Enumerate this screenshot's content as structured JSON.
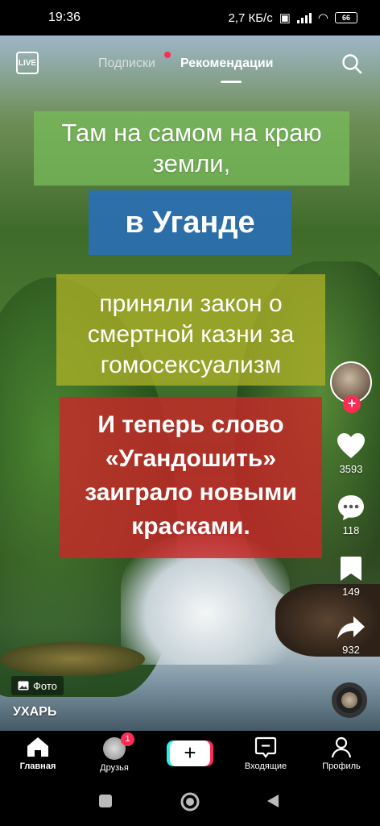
{
  "status_bar": {
    "time": "19:36",
    "net_speed": "2,7 КБ/с",
    "battery": "66"
  },
  "top_nav": {
    "live_label": "LIVE",
    "tabs": [
      {
        "label": "Подписки"
      },
      {
        "label": "Рекомендации"
      }
    ]
  },
  "captions": {
    "line1": "Там на самом на краю земли,",
    "line2": "в Уганде",
    "line3": "приняли закон о смертной казни за гомосексуализм",
    "line4": "И теперь слово «Угандошить» заиграло новыми красками."
  },
  "actions": {
    "likes": "3593",
    "comments": "118",
    "saves": "149",
    "shares": "932"
  },
  "post": {
    "badge_label": "Фото",
    "author": "УХАРЬ"
  },
  "bottom_nav": {
    "home": "Главная",
    "friends": "Друзья",
    "friends_badge": "1",
    "create": "+",
    "inbox": "Входящие",
    "profile": "Профиль"
  },
  "colors": {
    "accent_red": "#fe2c55",
    "accent_cyan": "#25f4ee"
  }
}
